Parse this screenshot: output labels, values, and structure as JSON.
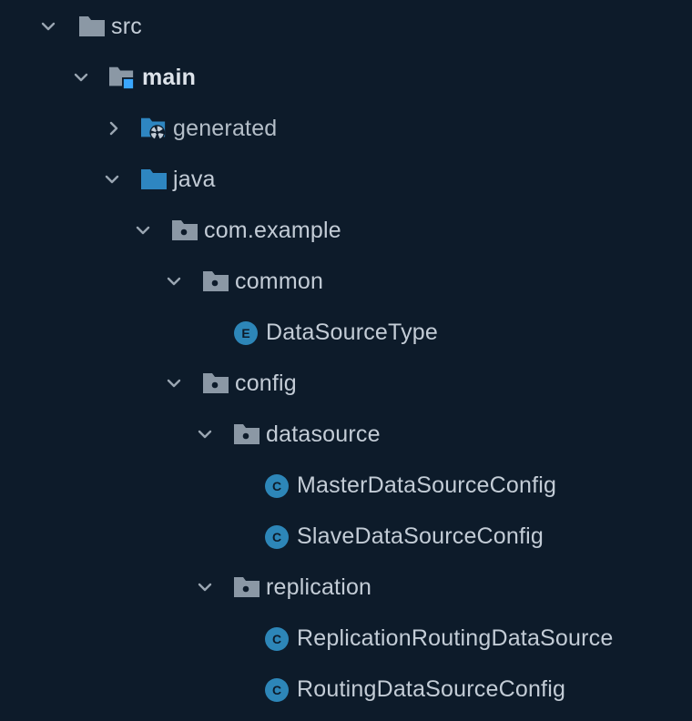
{
  "colors": {
    "background": "#0d1b2a",
    "chevron": "#9aa6b2",
    "folder_gray": "#8b98a5",
    "folder_blue": "#2e86c1",
    "module_marker": "#3aa7ff",
    "badge_bg": "#2d86b8",
    "badge_text": "#0d1b2a",
    "text": "#c3ccd6"
  },
  "tree": {
    "src": {
      "label": "src",
      "icon": "folder-icon"
    },
    "main": {
      "label": "main",
      "icon": "module-folder-icon"
    },
    "generated": {
      "label": "generated",
      "icon": "generated-folder-icon"
    },
    "java": {
      "label": "java",
      "icon": "source-root-folder-icon"
    },
    "com_example": {
      "label": "com.example",
      "icon": "package-icon"
    },
    "common": {
      "label": "common",
      "icon": "package-icon"
    },
    "datasource_type": {
      "label": "DataSourceType",
      "icon": "enum-icon",
      "badge": "E"
    },
    "config": {
      "label": "config",
      "icon": "package-icon"
    },
    "datasource": {
      "label": "datasource",
      "icon": "package-icon"
    },
    "master_config": {
      "label": "MasterDataSourceConfig",
      "icon": "class-icon",
      "badge": "C"
    },
    "slave_config": {
      "label": "SlaveDataSourceConfig",
      "icon": "class-icon",
      "badge": "C"
    },
    "replication": {
      "label": "replication",
      "icon": "package-icon"
    },
    "replication_routing": {
      "label": "ReplicationRoutingDataSource",
      "icon": "class-icon",
      "badge": "C"
    },
    "routing_config": {
      "label": "RoutingDataSourceConfig",
      "icon": "class-icon",
      "badge": "C"
    }
  }
}
